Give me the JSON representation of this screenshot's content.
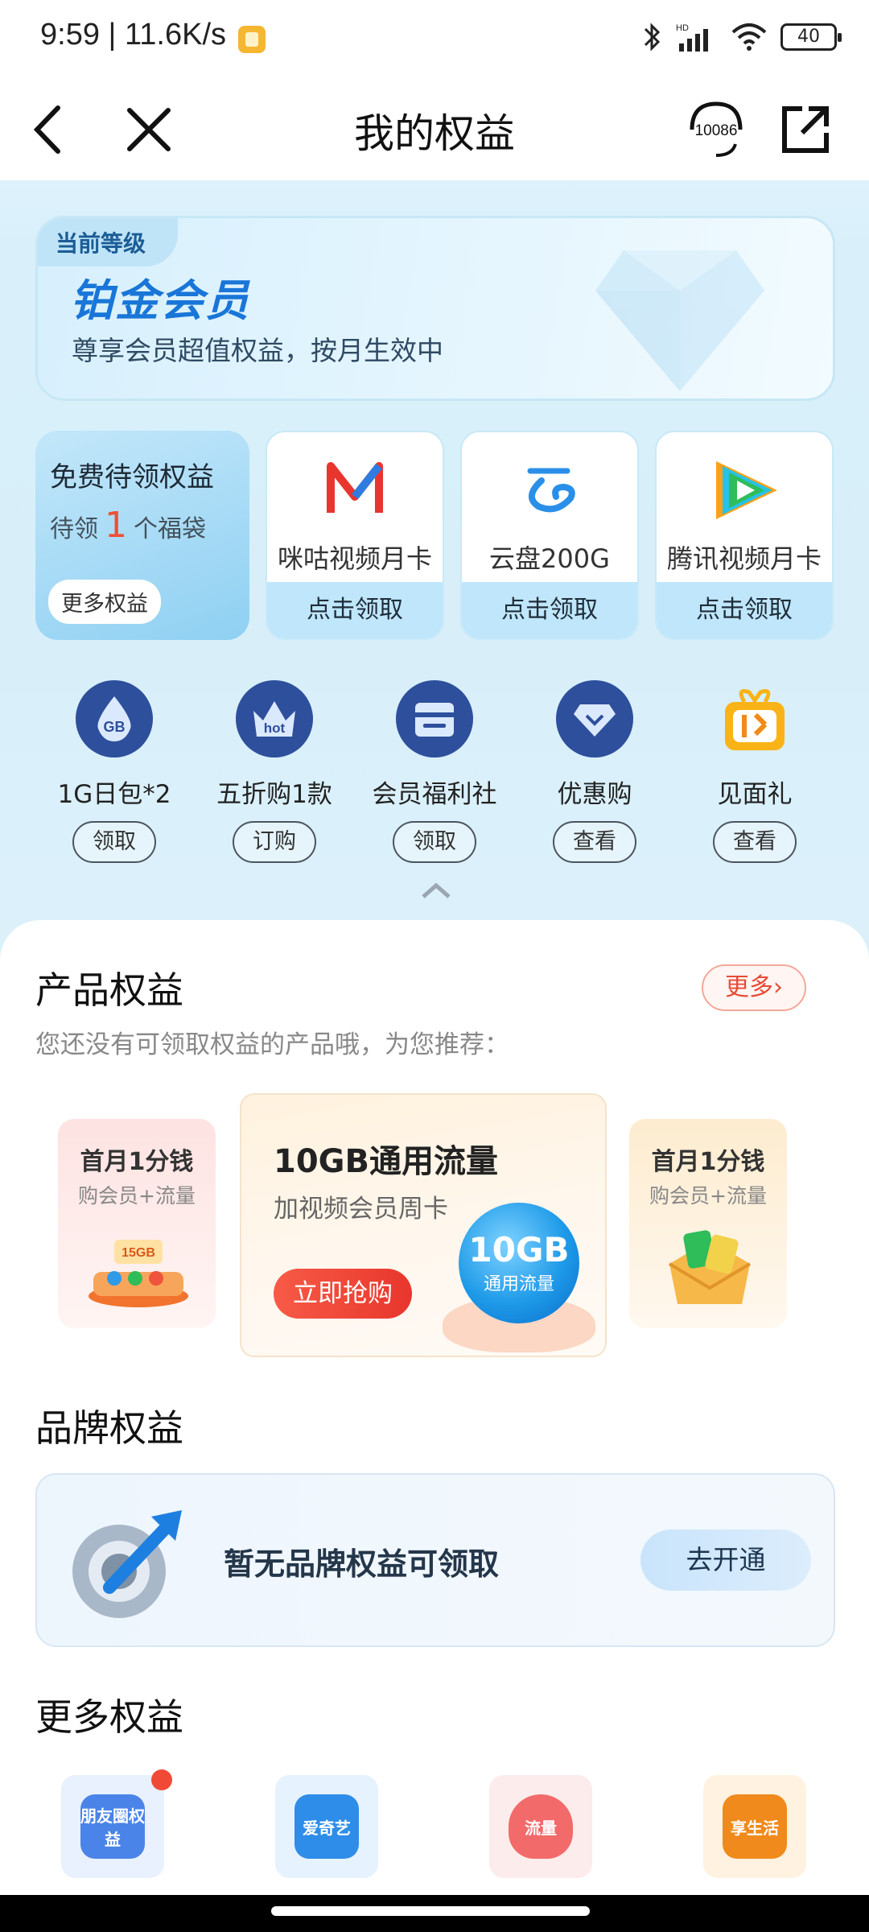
{
  "status_bar": {
    "time": "9:59",
    "speed": "11.6K/s",
    "battery": "40"
  },
  "header": {
    "title": "我的权益",
    "hotline": "10086"
  },
  "level_card": {
    "tag": "当前等级",
    "name": "铂金会员",
    "desc": "尊享会员超值权益，按月生效中"
  },
  "free_card": {
    "title": "免费待领权益",
    "sub_prefix": "待领",
    "count": "1",
    "sub_suffix": "个福袋",
    "more": "更多权益"
  },
  "service_cards": [
    {
      "name": "咪咕视频月卡",
      "action": "点击领取",
      "icon": "migu-video-icon"
    },
    {
      "name": "云盘200G",
      "action": "点击领取",
      "icon": "cloud-disk-icon"
    },
    {
      "name": "腾讯视频月卡",
      "action": "点击领取",
      "icon": "tencent-video-icon"
    }
  ],
  "mini_benefits": [
    {
      "label": "1G日包*2",
      "action": "领取",
      "icon_text": "GB"
    },
    {
      "label": "五折购1款",
      "action": "订购",
      "icon_text": "hot"
    },
    {
      "label": "会员福利社",
      "action": "领取",
      "icon_text": ""
    },
    {
      "label": "优惠购",
      "action": "查看",
      "icon_text": ""
    },
    {
      "label": "见面礼",
      "action": "查看",
      "icon_text": ""
    }
  ],
  "product_section": {
    "title": "产品权益",
    "more": "更多",
    "subtitle": "您还没有可领取权益的产品哦，为您推荐：",
    "promo_left": {
      "title": "首月1分钱",
      "sub": "购会员+流量",
      "badge": "15GB"
    },
    "promo_main": {
      "title": "10GB通用流量",
      "sub": "加视频会员周卡",
      "button": "立即抢购",
      "ball_big": "10GB",
      "ball_small": "通用流量"
    },
    "promo_right": {
      "title": "首月1分钱",
      "sub": "购会员+流量"
    }
  },
  "brand_section": {
    "title": "品牌权益",
    "text": "暂无品牌权益可领取",
    "button": "去开通"
  },
  "more_section": {
    "title": "更多权益",
    "items": [
      {
        "icon_text": "朋友圈权益",
        "label": "",
        "color": "#4a84e8",
        "bg": "#e8f1fd"
      },
      {
        "icon_text": "爱奇艺",
        "label": "",
        "color": "#2e8de8",
        "bg": "#e6f2fd"
      },
      {
        "icon_text": "流量",
        "label": "",
        "color": "#f26a6a",
        "bg": "#fdecec"
      },
      {
        "icon_text": "享生活",
        "label": "",
        "color": "#f08a1c",
        "bg": "#fff2e0"
      }
    ]
  },
  "colors": {
    "accent": "#1976d8",
    "red": "#e8362c",
    "bg_blue": "#d9f0fb"
  }
}
